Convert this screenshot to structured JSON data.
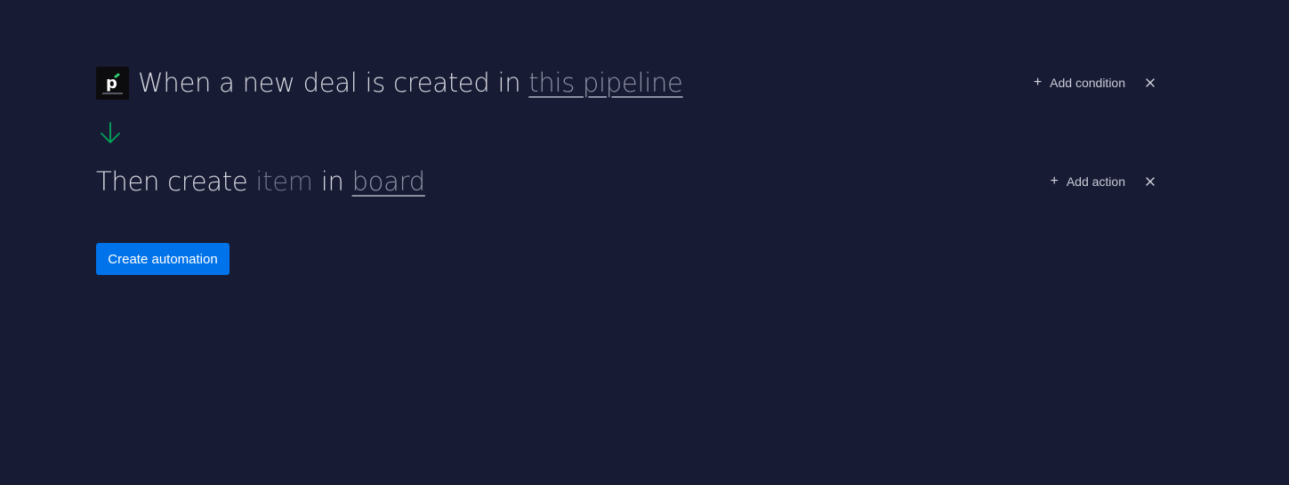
{
  "trigger": {
    "app_icon": "pipedrive-logo",
    "text_when": "When",
    "text_a": "a",
    "text_new": "new",
    "text_deal": "deal",
    "text_is": "is",
    "text_created": "created",
    "text_in": "in",
    "link_pipeline": "this pipeline",
    "add_condition_label": "Add condition",
    "add_icon": "plus-icon",
    "close_icon": "close-icon"
  },
  "arrow_icon": "arrow-down-icon",
  "action": {
    "text_then": "Then",
    "text_create": "create",
    "placeholder_item": "item",
    "text_in": "in",
    "link_board": "board",
    "add_action_label": "Add action",
    "add_icon": "plus-icon",
    "close_icon": "close-icon"
  },
  "footer": {
    "create_button_label": "Create automation"
  },
  "colors": {
    "background": "#181b34",
    "primary_text": "#d5d8df",
    "muted_text": "#6f7287",
    "link_text": "#8d90a3",
    "accent_green": "#00a65a",
    "button_blue": "#0073ea"
  }
}
